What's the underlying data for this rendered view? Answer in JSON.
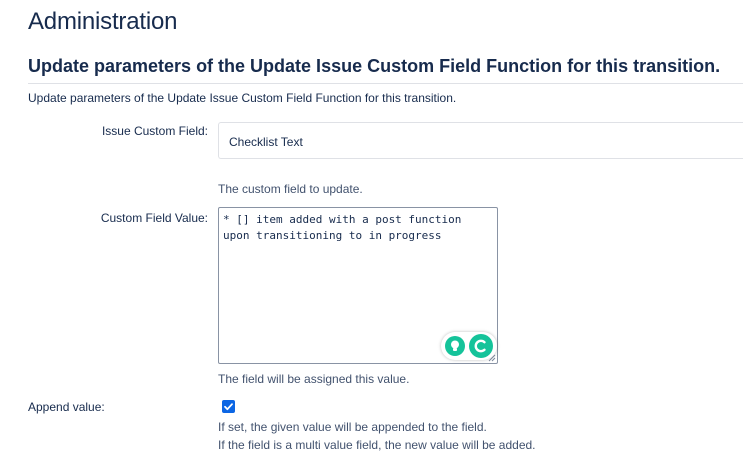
{
  "page": {
    "title": "Administration",
    "section_title": "Update parameters of the Update Issue Custom Field Function for this transition.",
    "description": "Update parameters of the Update Issue Custom Field Function for this transition."
  },
  "form": {
    "issue_custom_field": {
      "label": "Issue Custom Field:",
      "value": "Checklist Text",
      "help": "The custom field to update."
    },
    "custom_field_value": {
      "label": "Custom Field Value:",
      "value": "* [] item added with a post function\nupon transitioning to in progress",
      "help": "The field will be assigned this value."
    },
    "append_value": {
      "label": "Append value:",
      "checked": true,
      "help_line1": "If set, the given value will be appended to the field.",
      "help_line2": "If the field is a multi value field, the new value will be added."
    }
  },
  "icons": {
    "grammar_suggestion": "lightbulb-icon",
    "grammar_logo": "grammarly-c-icon",
    "resize": "resize-grip-icon",
    "checkbox": "checkmark-icon"
  },
  "colors": {
    "accent": "#0c66e4",
    "grammar": "#15c39a",
    "text": "#172b4d",
    "muted": "#42526e"
  }
}
